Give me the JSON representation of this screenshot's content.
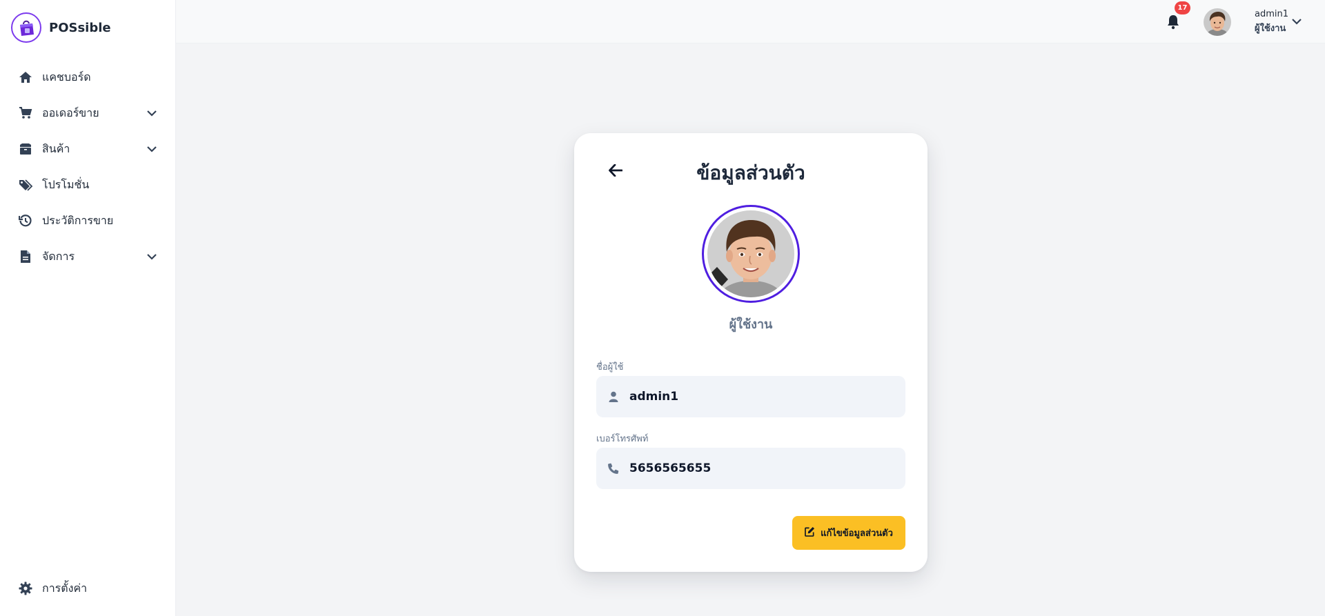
{
  "brand": {
    "name": "POSsible",
    "logo_icon": "shopping-bag-icon",
    "accent": "#7c3aed"
  },
  "sidebar": {
    "items": [
      {
        "label": "แคชบอร์ด",
        "icon": "home-icon",
        "expandable": false
      },
      {
        "label": "ออเดอร์ขาย",
        "icon": "cart-icon",
        "expandable": true
      },
      {
        "label": "สินค้า",
        "icon": "box-icon",
        "expandable": true
      },
      {
        "label": "โปรโมชั่น",
        "icon": "tags-icon",
        "expandable": false
      },
      {
        "label": "ประวัติการขาย",
        "icon": "history-icon",
        "expandable": false
      },
      {
        "label": "จัดการ",
        "icon": "file-icon",
        "expandable": true
      }
    ],
    "settings": {
      "label": "การตั้งค่า",
      "icon": "gear-icon"
    }
  },
  "topbar": {
    "notifications": {
      "count": "17",
      "icon": "bell-icon",
      "badge_color": "#ef4444"
    },
    "user": {
      "name": "admin1",
      "role": "ผู้ใช้งาน"
    }
  },
  "profile": {
    "title": "ข้อมูลส่วนตัว",
    "role": "ผู้ใช้งาน",
    "avatar_ring_color": "#4f1ee0",
    "fields": {
      "username": {
        "label": "ชื่อผู้ใช้",
        "value": "admin1",
        "icon": "user-icon"
      },
      "phone": {
        "label": "เบอร์โทรศัพท์",
        "value": "5656565655",
        "icon": "phone-icon"
      }
    },
    "edit_button": {
      "label": "แก้ไขข้อมูลส่วนตัว",
      "icon": "edit-icon",
      "color": "#fbbf24"
    }
  }
}
